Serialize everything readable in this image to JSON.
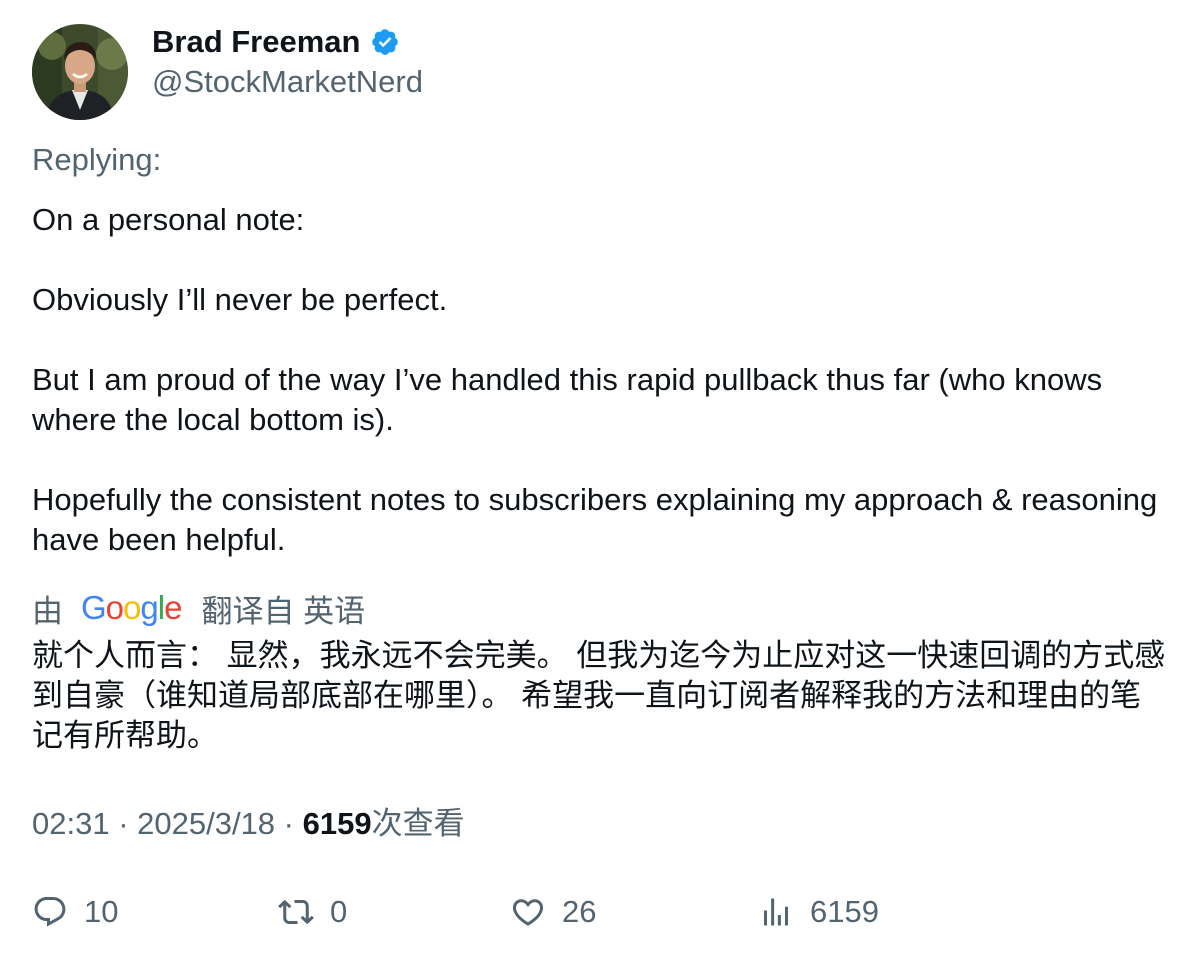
{
  "author": {
    "display_name": "Brad Freeman",
    "handle": "@StockMarketNerd",
    "verified_icon": "verified-badge-icon",
    "avatar_icon": "profile-avatar"
  },
  "replying_label": "Replying:",
  "tweet": {
    "paragraphs": [
      "On a personal note:",
      "Obviously I’ll never be perfect.",
      "But I am proud of the way I’ve handled this rapid pullback thus far (who knows where the local bottom is).",
      "Hopefully the consistent notes to subscribers explaining my approach & reasoning have been helpful."
    ]
  },
  "translation": {
    "by_label": "由",
    "google_letters": [
      "G",
      "o",
      "o",
      "g",
      "l",
      "e"
    ],
    "google_colors": [
      "#4285F4",
      "#EA4335",
      "#FBBC05",
      "#4285F4",
      "#34A853",
      "#EA4335"
    ],
    "from_label": "翻译自 英语",
    "text": "就个人而言： 显然，我永远不会完美。 但我为迄今为止应对这一快速回调的方式感到自豪（谁知道局部底部在哪里）。 希望我一直向订阅者解释我的方法和理由的笔记有所帮助。"
  },
  "meta": {
    "time": "02:31",
    "separator": " · ",
    "date": "2025/3/18",
    "views_count": "6159",
    "views_label": "次查看"
  },
  "actions": {
    "reply": {
      "icon": "reply-icon",
      "count": "10"
    },
    "retweet": {
      "icon": "retweet-icon",
      "count": "0"
    },
    "like": {
      "icon": "heart-icon",
      "count": "26"
    },
    "views": {
      "icon": "analytics-icon",
      "count": "6159"
    }
  },
  "colors": {
    "verified": "#1d9bf0",
    "text_primary": "#0f1419",
    "text_secondary": "#536471"
  }
}
